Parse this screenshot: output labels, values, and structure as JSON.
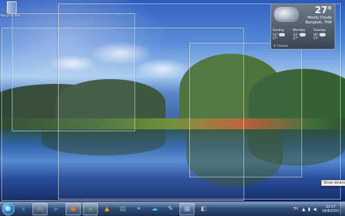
{
  "desktop": {
    "recycle_bin_label": "Recycle Bin"
  },
  "weather_gadget": {
    "temperature": "27°",
    "condition": "Mostly Cloudy",
    "location": "Bangkok, THA",
    "provider": "© Foreca",
    "forecast": [
      {
        "day": "Sunday",
        "high": "33°",
        "low": "27°"
      },
      {
        "day": "Monday",
        "high": "33°",
        "low": "27°"
      },
      {
        "day": "Tuesday",
        "high": "30°",
        "low": "27°"
      }
    ]
  },
  "taskbar": {
    "pinned": [
      {
        "name": "ie-icon",
        "glyph": "e"
      },
      {
        "name": "explorer-icon",
        "glyph": "▭"
      },
      {
        "name": "media-player-icon",
        "glyph": "▶"
      },
      {
        "name": "firefox-icon",
        "glyph": "●"
      },
      {
        "name": "chrome-icon",
        "glyph": "◉"
      },
      {
        "name": "vlc-icon",
        "glyph": "▲"
      },
      {
        "name": "app-icon-1",
        "glyph": "▤"
      },
      {
        "name": "app-icon-2",
        "glyph": "✦"
      },
      {
        "name": "app-icon-3",
        "glyph": "☁"
      },
      {
        "name": "app-icon-4",
        "glyph": "✎"
      },
      {
        "name": "app-icon-5",
        "glyph": "▦"
      },
      {
        "name": "app-icon-6",
        "glyph": "◧"
      }
    ],
    "language": "TH",
    "clock_time": "22:17",
    "clock_date": "19/8/2552",
    "show_desktop_tooltip": "Show desktop"
  }
}
